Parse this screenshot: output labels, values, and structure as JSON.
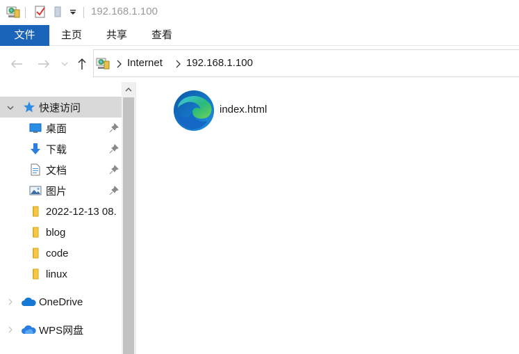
{
  "window": {
    "title": "192.168.1.100"
  },
  "ribbon": {
    "tabs": [
      "文件",
      "主页",
      "共享",
      "查看"
    ]
  },
  "address": {
    "crumbs": [
      "Internet",
      "192.168.1.100"
    ]
  },
  "nav_pane": {
    "quick_access": {
      "label": "快速访问",
      "icon": "star-icon"
    },
    "pinned": [
      {
        "label": "桌面",
        "icon": "desktop-icon"
      },
      {
        "label": "下载",
        "icon": "download-icon"
      },
      {
        "label": "文档",
        "icon": "document-icon"
      },
      {
        "label": "图片",
        "icon": "pictures-icon"
      }
    ],
    "folders": [
      "2022-12-13 08.",
      "blog",
      "code",
      "linux"
    ],
    "onedrive": {
      "label": "OneDrive",
      "icon": "cloud-icon"
    },
    "wps": {
      "label": "WPS网盘",
      "icon": "wps-cloud-icon"
    }
  },
  "content": {
    "files": [
      {
        "name": "index.html",
        "icon": "edge-icon"
      }
    ]
  },
  "colors": {
    "accent": "#1a64b9",
    "selection": "#d9d9d9",
    "folder": "#f6c945"
  }
}
